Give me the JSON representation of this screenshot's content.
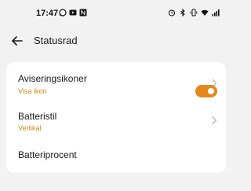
{
  "status_bar": {
    "time": "17:47",
    "left_icons": [
      "whatsapp-icon",
      "youtube-icon",
      "app-notification-icon"
    ],
    "right_icons": [
      "alarm-icon",
      "bluetooth-icon",
      "vibrate-icon",
      "wifi-icon",
      "signal-icon"
    ]
  },
  "header": {
    "title": "Statusrad",
    "back_icon": "arrow-left-icon"
  },
  "settings": {
    "items": [
      {
        "label": "Aviseringsikoner",
        "value": "Visa ikon"
      },
      {
        "label": "Batteristil",
        "value": "Vertikal"
      },
      {
        "label": "Batteriprocent",
        "toggle_on": true
      }
    ]
  },
  "colors": {
    "accent": "#E3891C",
    "value_text": "#D98A13",
    "background": "#F2F2F2",
    "card": "#FFFFFF"
  }
}
